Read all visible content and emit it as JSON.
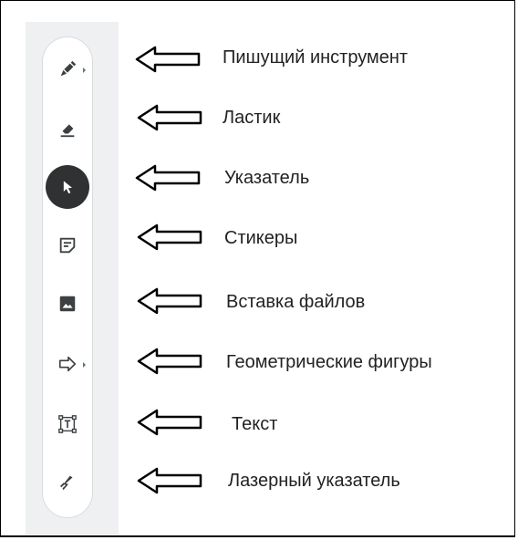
{
  "tools": [
    {
      "icon": "pen-icon",
      "label": "Пишущий инструмент",
      "has_submenu": true
    },
    {
      "icon": "eraser-icon",
      "label": "Ластик",
      "has_submenu": false
    },
    {
      "icon": "pointer-icon",
      "label": "Указатель",
      "has_submenu": false,
      "active": true
    },
    {
      "icon": "sticky-note-icon",
      "label": "Стикеры",
      "has_submenu": false
    },
    {
      "icon": "image-icon",
      "label": "Вставка файлов",
      "has_submenu": false
    },
    {
      "icon": "shape-arrow-icon",
      "label": "Геометрические фигуры",
      "has_submenu": true
    },
    {
      "icon": "text-box-icon",
      "label": "Текст",
      "has_submenu": false
    },
    {
      "icon": "laser-pointer-icon",
      "label": "Лазерный указатель",
      "has_submenu": false
    }
  ],
  "colors": {
    "active_tool_bg": "#2f3133",
    "icon": "#3c4043",
    "panel_bg": "#eef0f2"
  }
}
